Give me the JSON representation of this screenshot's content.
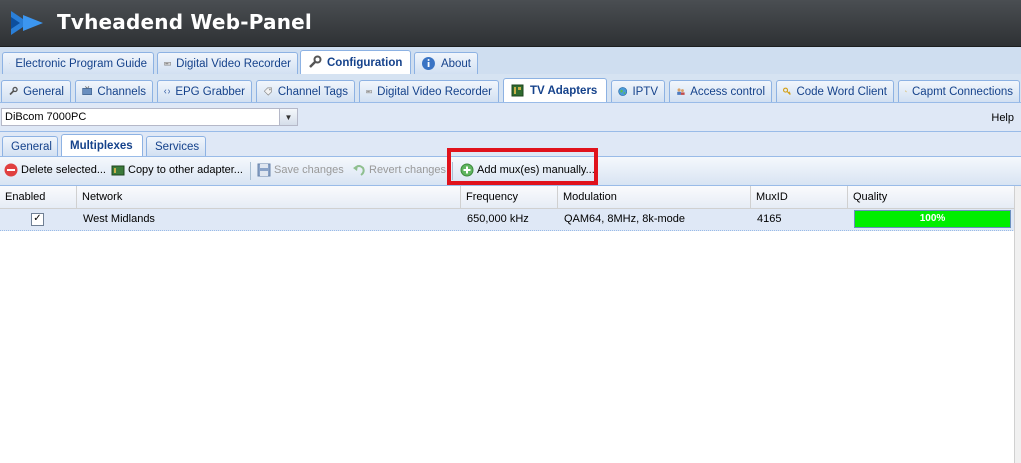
{
  "app": {
    "title": "Tvheadend Web-Panel"
  },
  "main_tabs": [
    {
      "label": "Electronic Program Guide",
      "icon": "tag-icon"
    },
    {
      "label": "Digital Video Recorder",
      "icon": "recorder-icon"
    },
    {
      "label": "Configuration",
      "icon": "wrench-icon",
      "active": true
    },
    {
      "label": "About",
      "icon": "info-icon"
    }
  ],
  "config_tabs": [
    {
      "label": "General",
      "icon": "wrench-icon"
    },
    {
      "label": "Channels",
      "icon": "tv-icon"
    },
    {
      "label": "EPG Grabber",
      "icon": "code-icon"
    },
    {
      "label": "Channel Tags",
      "icon": "tag-icon"
    },
    {
      "label": "Digital Video Recorder",
      "icon": "recorder-icon"
    },
    {
      "label": "TV Adapters",
      "icon": "adapter-icon",
      "active": true
    },
    {
      "label": "IPTV",
      "icon": "globe-icon"
    },
    {
      "label": "Access control",
      "icon": "users-icon"
    },
    {
      "label": "Code Word Client",
      "icon": "key-icon"
    },
    {
      "label": "Capmt Connections",
      "icon": "key-icon"
    }
  ],
  "adapter_select": {
    "value": "DiBcom 7000PC"
  },
  "help_label": "Help",
  "adapter_tabs": [
    {
      "label": "General"
    },
    {
      "label": "Multiplexes",
      "active": true
    },
    {
      "label": "Services"
    }
  ],
  "toolbar": {
    "delete_label": "Delete selected...",
    "copy_label": "Copy to other adapter...",
    "save_label": "Save changes",
    "revert_label": "Revert changes",
    "add_label": "Add mux(es) manually..."
  },
  "grid": {
    "columns": [
      "Enabled",
      "Network",
      "Frequency",
      "Modulation",
      "MuxID",
      "Quality"
    ],
    "rows": [
      {
        "enabled": true,
        "network": "West Midlands",
        "frequency": "650,000 kHz",
        "modulation": "QAM64, 8MHz, 8k-mode",
        "muxid": "4165",
        "quality_text": "100%",
        "quality": 1.0
      }
    ]
  },
  "colors": {
    "highlight": "#e0121c",
    "quality_fill": "#00ee00",
    "accent": "#15428b"
  }
}
